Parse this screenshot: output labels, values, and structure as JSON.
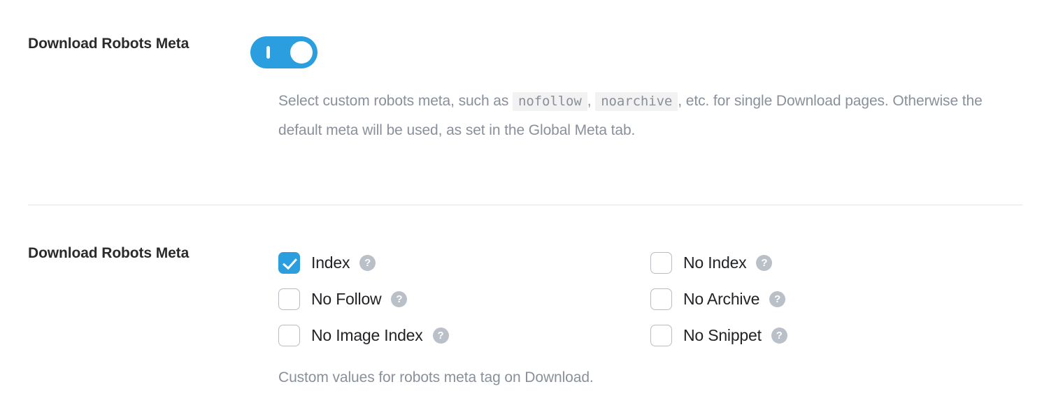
{
  "colors": {
    "accent": "#2b9ee0",
    "label_text": "#2b2b2d",
    "muted_text": "#8a9099",
    "checkbox_border": "#b9bcc1",
    "help_icon_bg": "#b9c0c8",
    "divider": "#e3e3e5",
    "code_bg": "#f2f2f2"
  },
  "toggle_section": {
    "label": "Download Robots Meta",
    "toggle": {
      "name": "download-robots-meta-toggle",
      "state": "on",
      "aria_label": "Download Robots Meta"
    },
    "description": {
      "part1": "Select custom robots meta, such as",
      "code1": "nofollow",
      "sep1": ",",
      "code2": "noarchive",
      "part2": ", etc. for single Download pages. Otherwise the default meta will be used, as set in the Global Meta tab."
    }
  },
  "checkbox_section": {
    "label": "Download Robots Meta",
    "rows": [
      {
        "left": {
          "label": "Index",
          "checked": true,
          "help": "?"
        },
        "right": {
          "label": "No Index",
          "checked": false,
          "help": "?"
        }
      },
      {
        "left": {
          "label": "No Follow",
          "checked": false,
          "help": "?"
        },
        "right": {
          "label": "No Archive",
          "checked": false,
          "help": "?"
        }
      },
      {
        "left": {
          "label": "No Image Index",
          "checked": false,
          "help": "?"
        },
        "right": {
          "label": "No Snippet",
          "checked": false,
          "help": "?"
        }
      }
    ],
    "footnote": "Custom values for robots meta tag on Download."
  }
}
